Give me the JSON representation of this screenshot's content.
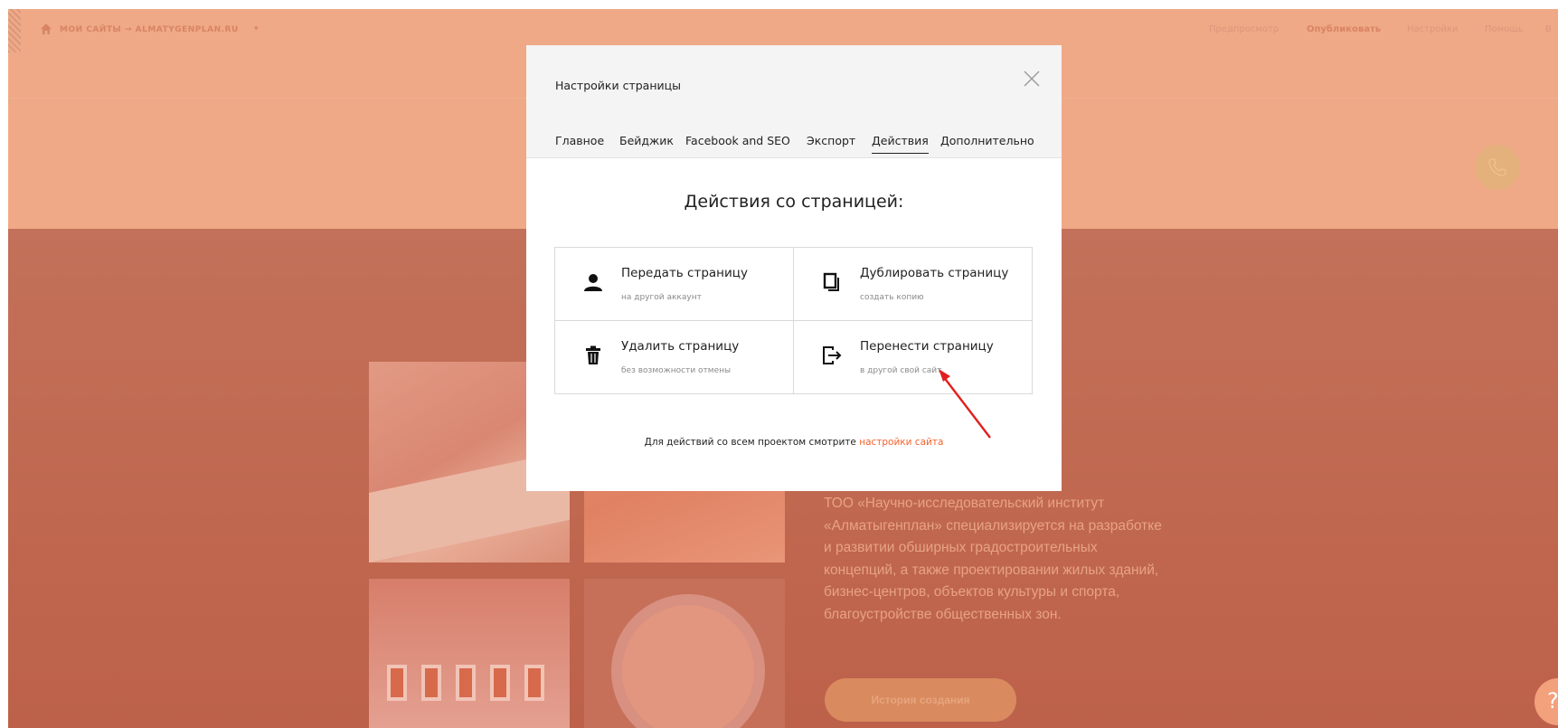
{
  "topbar": {
    "breadcrumb": "МОИ САЙТЫ → ALMATYGENPLAN.RU",
    "caret": "▾",
    "nav": [
      "Предпросмотр",
      "Опубликовать",
      "Настройки",
      "Помощь",
      "В"
    ]
  },
  "page": {
    "about_text": "ТОО «Научно-исследовательский институт «Алматыгенплан» специализируется на разработке и развитии обширных градостроительных концепций, а также проектировании жилых зданий, бизнес-центров, объектов культуры и спорта, благоустройстве общественных зон.",
    "history_button": "История создания",
    "help_label": "?"
  },
  "modal": {
    "title": "Настройки страницы",
    "tabs": [
      "Главное",
      "Бейджик",
      "Facebook and SEO",
      "Экспорт",
      "Действия",
      "Дополнительно"
    ],
    "active_tab": "Действия",
    "heading": "Действия со страницей:",
    "actions": [
      {
        "title": "Передать страницу",
        "subtitle": "на другой аккаунт",
        "icon": "user-icon"
      },
      {
        "title": "Дублировать страницу",
        "subtitle": "создать копию",
        "icon": "duplicate-icon"
      },
      {
        "title": "Удалить страницу",
        "subtitle": "без возможности отмены",
        "icon": "trash-icon"
      },
      {
        "title": "Перенести страницу",
        "subtitle": "в другой свой сайт",
        "icon": "move-out-icon"
      }
    ],
    "footer_text": "Для действий со всем проектом смотрите ",
    "footer_link": "настройки сайта"
  },
  "colors": {
    "hero_band": "#efa987",
    "lower_band": "#c3715a",
    "accent_link": "#f4622d",
    "annotation_arrow": "#e02020"
  }
}
